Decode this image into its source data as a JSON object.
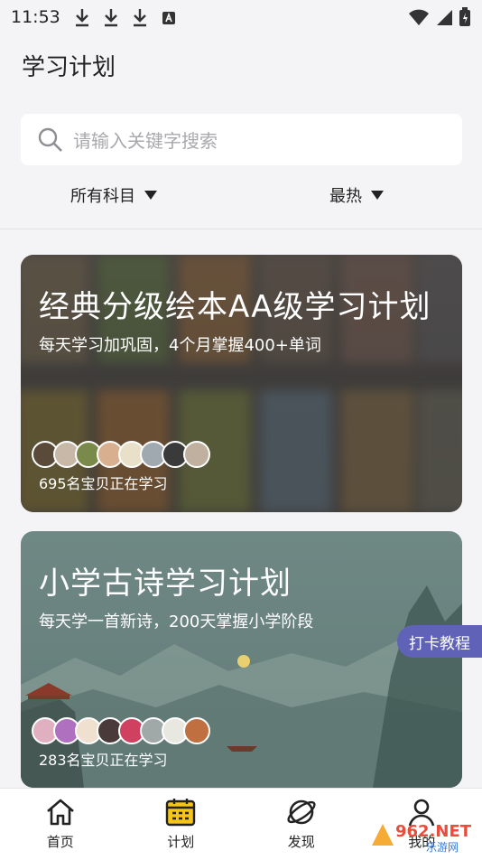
{
  "status_bar": {
    "time": "11:53"
  },
  "page": {
    "title": "学习计划"
  },
  "search": {
    "placeholder": "请输入关键字搜索"
  },
  "filters": {
    "subject": "所有科目",
    "sort": "最热"
  },
  "plans": [
    {
      "title": "经典分级绘本AA级学习计划",
      "subtitle": "每天学习加巩固，4个月掌握400+单词",
      "learners": "695名宝贝正在学习"
    },
    {
      "title": "小学古诗学习计划",
      "subtitle": "每天学一首新诗，200天掌握小学阶段",
      "learners": "283名宝贝正在学习"
    }
  ],
  "float_button": {
    "label": "打卡教程"
  },
  "tabs": [
    {
      "label": "首页"
    },
    {
      "label": "计划"
    },
    {
      "label": "发现"
    },
    {
      "label": "我的"
    }
  ],
  "watermark": {
    "text": "962.NET",
    "subtext": "乐游网"
  },
  "colors": {
    "accent": "#6062b8",
    "background": "#f4f4f6"
  }
}
